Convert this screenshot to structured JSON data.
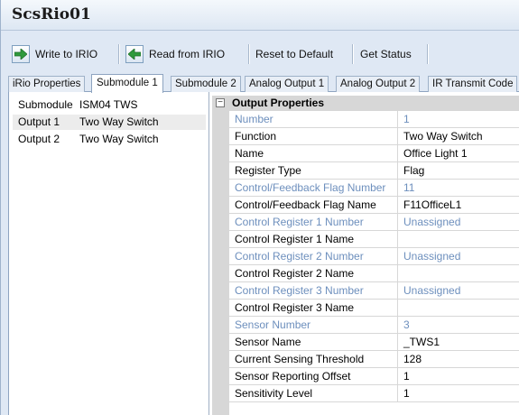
{
  "window": {
    "title": "ScsRio01"
  },
  "toolbar": {
    "write_label": "Write to IRIO",
    "read_label": "Read from IRIO",
    "reset_label": "Reset to Default",
    "status_label": "Get Status"
  },
  "tabs": [
    {
      "label": "iRio Properties"
    },
    {
      "label": "Submodule 1"
    },
    {
      "label": "Submodule 2"
    },
    {
      "label": "Analog Output 1"
    },
    {
      "label": "Analog Output 2"
    },
    {
      "label": "IR Transmit Code"
    }
  ],
  "submodules": [
    {
      "name": "Submodule",
      "value": "ISM04 TWS"
    },
    {
      "name": "Output 1",
      "value": "Two Way Switch"
    },
    {
      "name": "Output 2",
      "value": "Two Way Switch"
    }
  ],
  "property_grid": {
    "category": "Output Properties",
    "toggle_symbol": "−",
    "rows": [
      {
        "name": "Number",
        "value": "1"
      },
      {
        "name": "Function",
        "value": "Two Way Switch"
      },
      {
        "name": "Name",
        "value": "Office Light 1"
      },
      {
        "name": "Register Type",
        "value": "Flag"
      },
      {
        "name": "Control/Feedback Flag Number",
        "value": "11"
      },
      {
        "name": "Control/Feedback Flag Name",
        "value": "F11OfficeL1"
      },
      {
        "name": "Control Register 1 Number",
        "value": "Unassigned"
      },
      {
        "name": "Control Register 1 Name",
        "value": ""
      },
      {
        "name": "Control Register 2 Number",
        "value": "Unassigned"
      },
      {
        "name": "Control Register 2 Name",
        "value": ""
      },
      {
        "name": "Control Register 3 Number",
        "value": "Unassigned"
      },
      {
        "name": "Control Register 3 Name",
        "value": ""
      },
      {
        "name": "Sensor Number",
        "value": "3"
      },
      {
        "name": "Sensor Name",
        "value": "_TWS1"
      },
      {
        "name": "Current Sensing Threshold",
        "value": "128"
      },
      {
        "name": "Sensor Reporting Offset",
        "value": "1"
      },
      {
        "name": "Sensitivity Level",
        "value": "1"
      }
    ]
  },
  "colors": {
    "readonly_text": "#6d8fbd",
    "accent_arrow": "#2f9a3c",
    "grid_line": "#d7d7d7"
  }
}
